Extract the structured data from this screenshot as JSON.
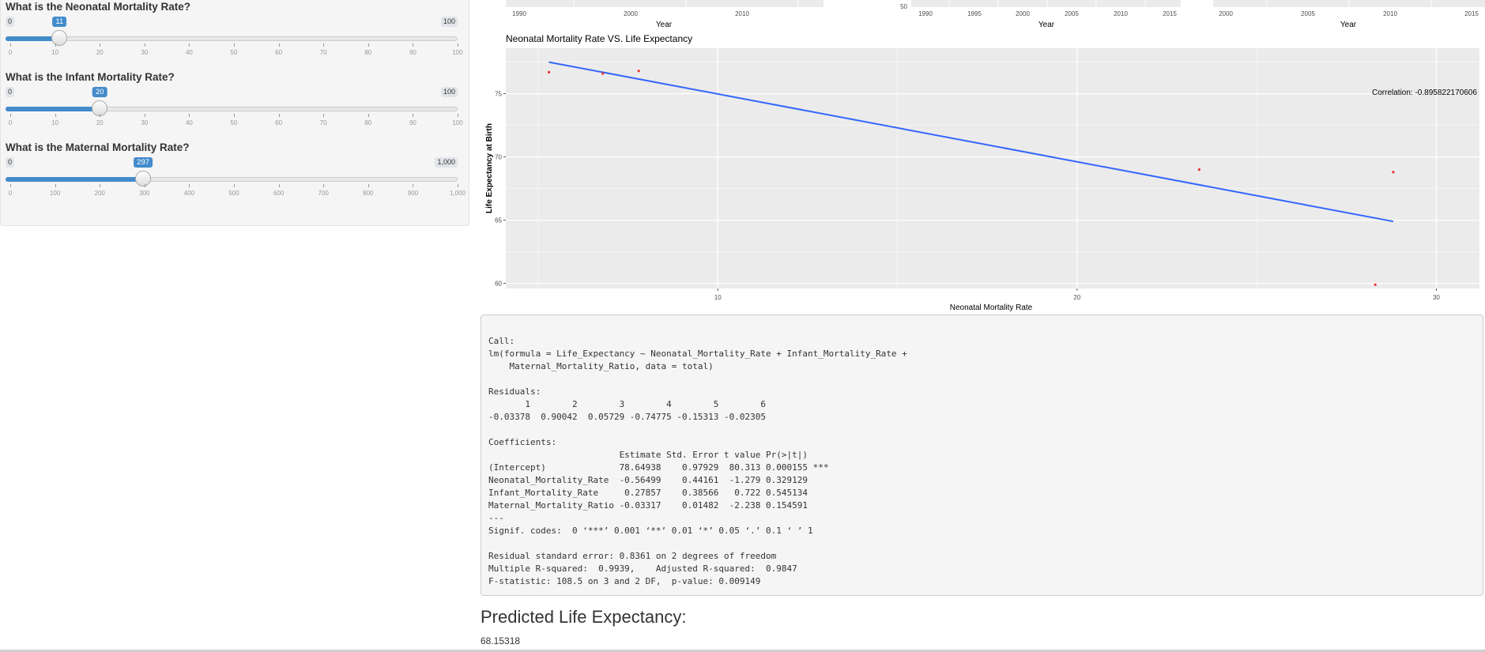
{
  "sliders": [
    {
      "label": "What is the Neonatal Mortality Rate?",
      "min": 0,
      "max": 100,
      "value": 11,
      "min_label": "0",
      "max_label": "100",
      "value_label": "11",
      "ticks": [
        "0",
        "10",
        "20",
        "30",
        "40",
        "50",
        "60",
        "70",
        "80",
        "90",
        "100"
      ]
    },
    {
      "label": "What is the Infant Mortality Rate?",
      "min": 0,
      "max": 100,
      "value": 20,
      "min_label": "0",
      "max_label": "100",
      "value_label": "20",
      "ticks": [
        "0",
        "10",
        "20",
        "30",
        "40",
        "50",
        "60",
        "70",
        "80",
        "90",
        "100"
      ]
    },
    {
      "label": "What is the Maternal Mortality Rate?",
      "min": 0,
      "max": 1000,
      "value": 297,
      "min_label": "0",
      "max_label": "1,000",
      "value_label": "297",
      "ticks": [
        "0",
        "100",
        "200",
        "300",
        "400",
        "500",
        "600",
        "700",
        "800",
        "900",
        "1,000"
      ]
    }
  ],
  "top_plots": [
    {
      "xlabel": "Year",
      "x_ticks": [
        "1990",
        "2000",
        "2010"
      ],
      "y_ticks": []
    },
    {
      "xlabel": "Year",
      "x_ticks": [
        "1990",
        "1995",
        "2000",
        "2005",
        "2010",
        "2015"
      ],
      "y_ticks": [
        "50"
      ]
    },
    {
      "xlabel": "Year",
      "x_ticks": [
        "2000",
        "2005",
        "2010",
        "2015"
      ],
      "y_ticks": []
    }
  ],
  "chart_data": {
    "type": "scatter",
    "title": "Neonatal Mortality Rate VS. Life Expectancy",
    "xlabel": "Neonatal Mortality Rate",
    "ylabel": "Life Expectancy at Birth",
    "xlim": [
      4.1,
      31.2
    ],
    "ylim": [
      59.6,
      78.6
    ],
    "x_ticks": [
      10,
      20,
      30
    ],
    "y_ticks": [
      60,
      65,
      70,
      75
    ],
    "grid": true,
    "points": [
      {
        "x": 5.3,
        "y": 76.7
      },
      {
        "x": 6.8,
        "y": 76.6
      },
      {
        "x": 7.8,
        "y": 76.8
      },
      {
        "x": 23.4,
        "y": 69.0
      },
      {
        "x": 28.3,
        "y": 59.9
      },
      {
        "x": 28.8,
        "y": 68.8
      }
    ],
    "fit_line": [
      {
        "x": 5.3,
        "y": 77.5
      },
      {
        "x": 28.8,
        "y": 64.9
      }
    ],
    "annotation": "Correlation:  -0.895822170606",
    "point_color": "#e8312f",
    "line_color": "#3366ff",
    "panel_bg": "#ebebeb"
  },
  "regression_output": "Call:\nlm(formula = Life_Expectancy ~ Neonatal_Mortality_Rate + Infant_Mortality_Rate + \n    Maternal_Mortality_Ratio, data = total)\n\nResiduals:\n       1        2        3        4        5        6 \n-0.03378  0.90042  0.05729 -0.74775 -0.15313 -0.02305 \n\nCoefficients:\n                         Estimate Std. Error t value Pr(>|t|)    \n(Intercept)              78.64938    0.97929  80.313 0.000155 ***\nNeonatal_Mortality_Rate  -0.56499    0.44161  -1.279 0.329129    \nInfant_Mortality_Rate     0.27857    0.38566   0.722 0.545134    \nMaternal_Mortality_Ratio -0.03317    0.01482  -2.238 0.154591    \n---\nSignif. codes:  0 ‘***’ 0.001 ‘**’ 0.01 ‘*’ 0.05 ‘.’ 0.1 ‘ ’ 1\n\nResidual standard error: 0.8361 on 2 degrees of freedom\nMultiple R-squared:  0.9939,\tAdjusted R-squared:  0.9847 \nF-statistic: 108.5 on 3 and 2 DF,  p-value: 0.009149",
  "prediction": {
    "title": "Predicted Life Expectancy:",
    "value": "68.15318"
  }
}
